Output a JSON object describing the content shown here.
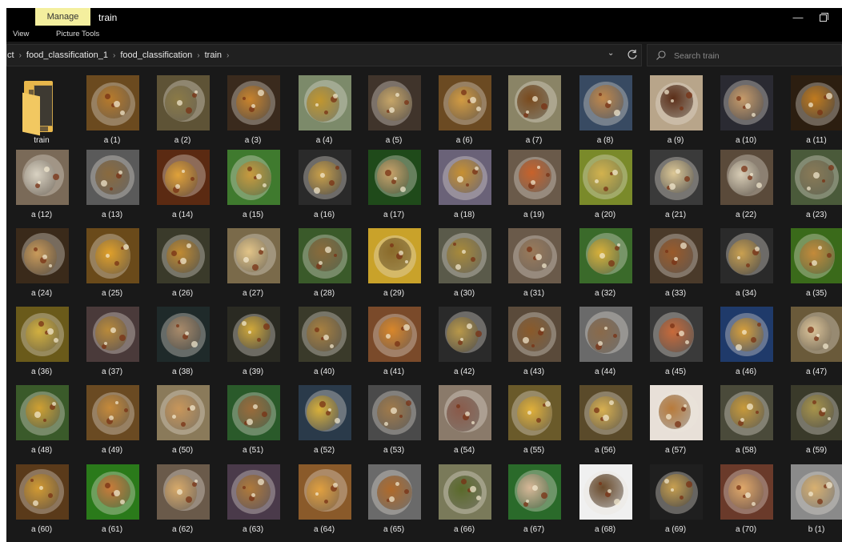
{
  "titlebar": {
    "manage_tab": "Manage",
    "title": "train",
    "ribbon_view": "View",
    "ribbon_picture_tools": "Picture Tools",
    "minimize_glyph": "—"
  },
  "address": {
    "crumbs": [
      "ct",
      "food_classification_1",
      "food_classification",
      "train"
    ],
    "separator": "›",
    "dropdown_glyph": "⌄"
  },
  "search": {
    "placeholder": "Search train"
  },
  "colors": {
    "window_bg": "#191919",
    "manage_tab": "#f4ef9e",
    "folder": "#e8b74b"
  },
  "items": [
    {
      "label": "train",
      "type": "folder"
    },
    {
      "label": "a (1)",
      "c": "#6b4a1f",
      "r": "#b77a2b"
    },
    {
      "label": "a (2)",
      "c": "#5e5336",
      "r": "#8b7a46"
    },
    {
      "label": "a (3)",
      "c": "#3a2a1d",
      "r": "#c9832c"
    },
    {
      "label": "a (4)",
      "c": "#7c8a6a",
      "r": "#c1962e"
    },
    {
      "label": "a (5)",
      "c": "#40342b",
      "r": "#c6a568"
    },
    {
      "label": "a (6)",
      "c": "#6b4a22",
      "r": "#d29b42"
    },
    {
      "label": "a (7)",
      "c": "#8a8466",
      "r": "#7a4a1d"
    },
    {
      "label": "a (8)",
      "c": "#384a62",
      "r": "#c0874a"
    },
    {
      "label": "a (9)",
      "c": "#b8a58a",
      "r": "#5b2e18"
    },
    {
      "label": "a (10)",
      "c": "#2a2a32",
      "r": "#c79b6a"
    },
    {
      "label": "a (11)",
      "c": "#2c1e10",
      "r": "#c07a1e"
    },
    {
      "label": "a (12)",
      "c": "#7a6a58",
      "r": "#d9d2c2"
    },
    {
      "label": "a (13)",
      "c": "#5a5a5a",
      "r": "#8a6a3e"
    },
    {
      "label": "a (14)",
      "c": "#5b2a12",
      "r": "#e0a23a"
    },
    {
      "label": "a (15)",
      "c": "#3f7a2e",
      "r": "#c99a3e"
    },
    {
      "label": "a (16)",
      "c": "#2a2a2a",
      "r": "#c9a04a"
    },
    {
      "label": "a (17)",
      "c": "#1f4a1a",
      "r": "#caa36a"
    },
    {
      "label": "a (18)",
      "c": "#6a6278",
      "r": "#c79032"
    },
    {
      "label": "a (19)",
      "c": "#6a5a4a",
      "r": "#c8622a"
    },
    {
      "label": "a (20)",
      "c": "#7a8a2a",
      "r": "#d2b24e"
    },
    {
      "label": "a (21)",
      "c": "#3a3a3a",
      "r": "#ddc896"
    },
    {
      "label": "a (22)",
      "c": "#5a4a3a",
      "r": "#d8cdb6"
    },
    {
      "label": "a (23)",
      "c": "#4a5a3a",
      "r": "#8a7a56"
    },
    {
      "label": "a (24)",
      "c": "#3a2a1a",
      "r": "#c99a5a"
    },
    {
      "label": "a (25)",
      "c": "#6a4a1a",
      "r": "#e0a02a"
    },
    {
      "label": "a (26)",
      "c": "#3a3a2a",
      "r": "#c08a32"
    },
    {
      "label": "a (27)",
      "c": "#7a6a4a",
      "r": "#e2c488"
    },
    {
      "label": "a (28)",
      "c": "#3a5a2a",
      "r": "#8a6a3a"
    },
    {
      "label": "a (29)",
      "c": "#c9a22a",
      "r": "#8a6a2a"
    },
    {
      "label": "a (30)",
      "c": "#5a5a4a",
      "r": "#a88a3a"
    },
    {
      "label": "a (31)",
      "c": "#6a5a4a",
      "r": "#9a7a5a"
    },
    {
      "label": "a (32)",
      "c": "#3a6a2a",
      "r": "#d8b03a"
    },
    {
      "label": "a (33)",
      "c": "#4a3a2a",
      "r": "#9a5a2a"
    },
    {
      "label": "a (34)",
      "c": "#2a2a2a",
      "r": "#c9a050"
    },
    {
      "label": "a (35)",
      "c": "#3a6a1a",
      "r": "#c48a3a"
    },
    {
      "label": "a (36)",
      "c": "#6a5a1a",
      "r": "#d2b040"
    },
    {
      "label": "a (37)",
      "c": "#4a3a3a",
      "r": "#b98a3a"
    },
    {
      "label": "a (38)",
      "c": "#1f2a2a",
      "r": "#a88a6a"
    },
    {
      "label": "a (39)",
      "c": "#2a2a22",
      "r": "#d0a83a"
    },
    {
      "label": "a (40)",
      "c": "#3a3a2a",
      "r": "#a88040"
    },
    {
      "label": "a (41)",
      "c": "#7a4a2a",
      "r": "#d8862a"
    },
    {
      "label": "a (42)",
      "c": "#2a2a2a",
      "r": "#b8984a"
    },
    {
      "label": "a (43)",
      "c": "#5a4a3a",
      "r": "#8a5a2a"
    },
    {
      "label": "a (44)",
      "c": "#6a6a6a",
      "r": "#8a6a4a"
    },
    {
      "label": "a (45)",
      "c": "#3a3a3a",
      "r": "#c86a3a"
    },
    {
      "label": "a (46)",
      "c": "#1f3a6a",
      "r": "#d8a03a"
    },
    {
      "label": "a (47)",
      "c": "#6a5a3a",
      "r": "#dcc49a"
    },
    {
      "label": "a (48)",
      "c": "#3a5a2a",
      "r": "#d0a032"
    },
    {
      "label": "a (49)",
      "c": "#6a4a22",
      "r": "#c68a3a"
    },
    {
      "label": "a (50)",
      "c": "#8a7a5a",
      "r": "#c8965a"
    },
    {
      "label": "a (51)",
      "c": "#2a5a2a",
      "r": "#9a6a3a"
    },
    {
      "label": "a (52)",
      "c": "#2a3a4a",
      "r": "#d8b03a"
    },
    {
      "label": "a (53)",
      "c": "#4a4a4a",
      "r": "#a07a4a"
    },
    {
      "label": "a (54)",
      "c": "#8a7a6a",
      "r": "#8a5a4a"
    },
    {
      "label": "a (55)",
      "c": "#6a5a2a",
      "r": "#e0b03a"
    },
    {
      "label": "a (56)",
      "c": "#5a4a2a",
      "r": "#d8b050"
    },
    {
      "label": "a (57)",
      "c": "#e8e0d8",
      "r": "#b87a3a"
    },
    {
      "label": "a (58)",
      "c": "#4a4a3a",
      "r": "#c89a3a"
    },
    {
      "label": "a (59)",
      "c": "#3a3a2a",
      "r": "#a8944a"
    },
    {
      "label": "a (60)",
      "c": "#5a3a1a",
      "r": "#d29a32"
    },
    {
      "label": "a (61)",
      "c": "#2a7a1a",
      "r": "#c97a3a"
    },
    {
      "label": "a (62)",
      "c": "#6a5a4a",
      "r": "#d8aa6a"
    },
    {
      "label": "a (63)",
      "c": "#4a3a4a",
      "r": "#b07a3a"
    },
    {
      "label": "a (64)",
      "c": "#8a5a2a",
      "r": "#e0a040"
    },
    {
      "label": "a (65)",
      "c": "#6a6a6a",
      "r": "#b06a2a"
    },
    {
      "label": "a (66)",
      "c": "#7a7a5a",
      "r": "#5a6a2a"
    },
    {
      "label": "a (67)",
      "c": "#2a6a2a",
      "r": "#d8b898"
    },
    {
      "label": "a (68)",
      "c": "#f0f0f0",
      "r": "#6a4a2a"
    },
    {
      "label": "a (69)",
      "c": "#1f1f1f",
      "r": "#c8a050"
    },
    {
      "label": "a (70)",
      "c": "#6a3a2a",
      "r": "#e0a86a"
    },
    {
      "label": "b (1)",
      "c": "#8a8a8a",
      "r": "#d8b070"
    }
  ]
}
